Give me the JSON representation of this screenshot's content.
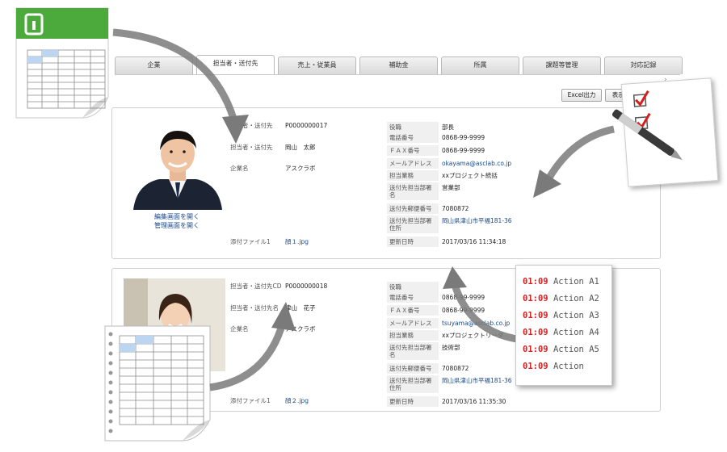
{
  "tabs": [
    "企業",
    "担当者・送付先",
    "売上・従業員",
    "補助金",
    "所属",
    "課題等管理",
    "対応記録"
  ],
  "active_tab_index": 1,
  "buttons": {
    "excel": "Excel出力",
    "display": "表示項"
  },
  "cards": [
    {
      "left": [
        {
          "label": "担当者・送付先",
          "value": "P0000000017"
        },
        {
          "label": "担当者・送付先",
          "value": "岡山　太郎"
        },
        {
          "label": "企業名",
          "value": "アスクラボ"
        }
      ],
      "links": [
        "編集画面を開く",
        "管理画面を開く"
      ],
      "attachment_label": "添付ファイル1",
      "attachment_value": "顔１.jpg",
      "right": [
        {
          "label": "役職",
          "value": "部長"
        },
        {
          "label": "電話番号",
          "value": "0868-99-9999"
        },
        {
          "label": "ＦＡＸ番号",
          "value": "0868-99-9999"
        },
        {
          "label": "メールアドレス",
          "value": "okayama@asclab.co.jp",
          "link": true
        },
        {
          "label": "担当業務",
          "value": "xxプロジェクト統括"
        },
        {
          "label": "送付先担当部署名",
          "value": "営業部"
        },
        {
          "label": "送付先郵便番号",
          "value": "7080872"
        },
        {
          "label": "送付先担当部署住所",
          "value": "岡山県津山市平福181-36",
          "link": true
        },
        {
          "label": "更新日時",
          "value": "2017/03/16 11:34:18"
        }
      ]
    },
    {
      "left": [
        {
          "label": "担当者・送付先CD",
          "value": "P0000000018"
        },
        {
          "label": "担当者・送付先名",
          "value": "津山　花子"
        },
        {
          "label": "企業名",
          "value": "アスクラボ"
        }
      ],
      "links": [],
      "attachment_label": "添付ファイル1",
      "attachment_value": "顔２.jpg",
      "right": [
        {
          "label": "役職",
          "value": ""
        },
        {
          "label": "電話番号",
          "value": "0868-99-9999"
        },
        {
          "label": "ＦＡＸ番号",
          "value": "0868-99-9999"
        },
        {
          "label": "メールアドレス",
          "value": "tsuyama@asclab.co.jp",
          "link": true
        },
        {
          "label": "担当業務",
          "value": "xxプロジェクトリーダ"
        },
        {
          "label": "送付先担当部署名",
          "value": "技術部"
        },
        {
          "label": "送付先郵便番号",
          "value": "7080872"
        },
        {
          "label": "送付先担当部署住所",
          "value": "岡山県津山市平福181-36",
          "link": true
        },
        {
          "label": "更新日時",
          "value": "2017/03/16 11:35:30"
        }
      ]
    }
  ],
  "action_log": [
    {
      "time": "01:09",
      "label": "Action A1"
    },
    {
      "time": "01:09",
      "label": "Action A2"
    },
    {
      "time": "01:09",
      "label": "Action A3"
    },
    {
      "time": "01:09",
      "label": "Action A4"
    },
    {
      "time": "01:09",
      "label": "Action A5"
    },
    {
      "time": "01:09",
      "label": "Action"
    }
  ],
  "colors": {
    "accent_green": "#4caa3c",
    "link_blue": "#1a4a8c",
    "time_red": "#d81d1d"
  },
  "icons": [
    "spreadsheet-icon",
    "checklist-icon",
    "pen-icon",
    "curved-arrow-icon"
  ]
}
